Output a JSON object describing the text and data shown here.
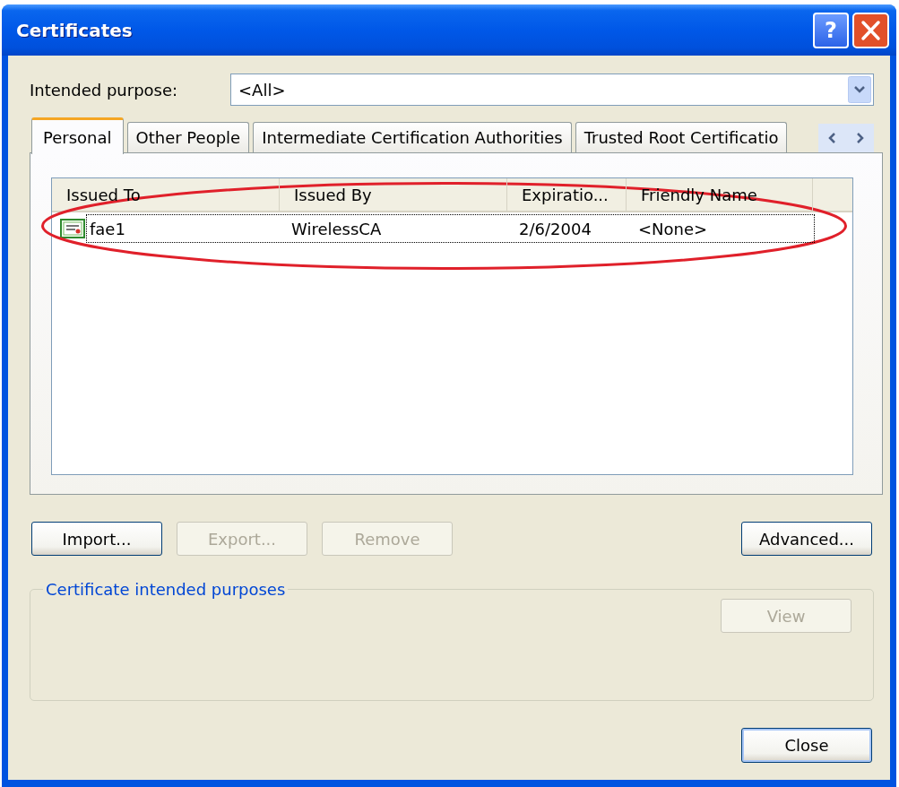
{
  "window": {
    "title": "Certificates",
    "help_label": "?"
  },
  "purpose": {
    "label": "Intended purpose:",
    "value": "<All>"
  },
  "tabs": [
    {
      "label": "Personal",
      "selected": true
    },
    {
      "label": "Other People",
      "selected": false
    },
    {
      "label": "Intermediate Certification Authorities",
      "selected": false
    },
    {
      "label": "Trusted Root Certificatio",
      "selected": false
    }
  ],
  "table": {
    "columns": [
      "Issued To",
      "Issued By",
      "Expiratio...",
      "Friendly Name"
    ],
    "rows": [
      {
        "cells": [
          "fae1",
          "WirelessCA",
          "2/6/2004",
          "<None>"
        ],
        "selected": false,
        "focused": true
      }
    ]
  },
  "annotation": {
    "kind": "ellipse"
  },
  "buttons": [
    {
      "label": "Import...",
      "disabled": false,
      "default": false
    },
    {
      "label": "Export...",
      "disabled": true,
      "default": false
    },
    {
      "label": "Remove",
      "disabled": true,
      "default": false
    }
  ],
  "advanced_button": {
    "label": "Advanced...",
    "disabled": false,
    "default": false
  },
  "group": {
    "title": "Certificate intended purposes",
    "button": {
      "label": "View",
      "disabled": true,
      "default": false
    }
  },
  "close_button": {
    "label": "Close",
    "disabled": false,
    "default": true
  }
}
